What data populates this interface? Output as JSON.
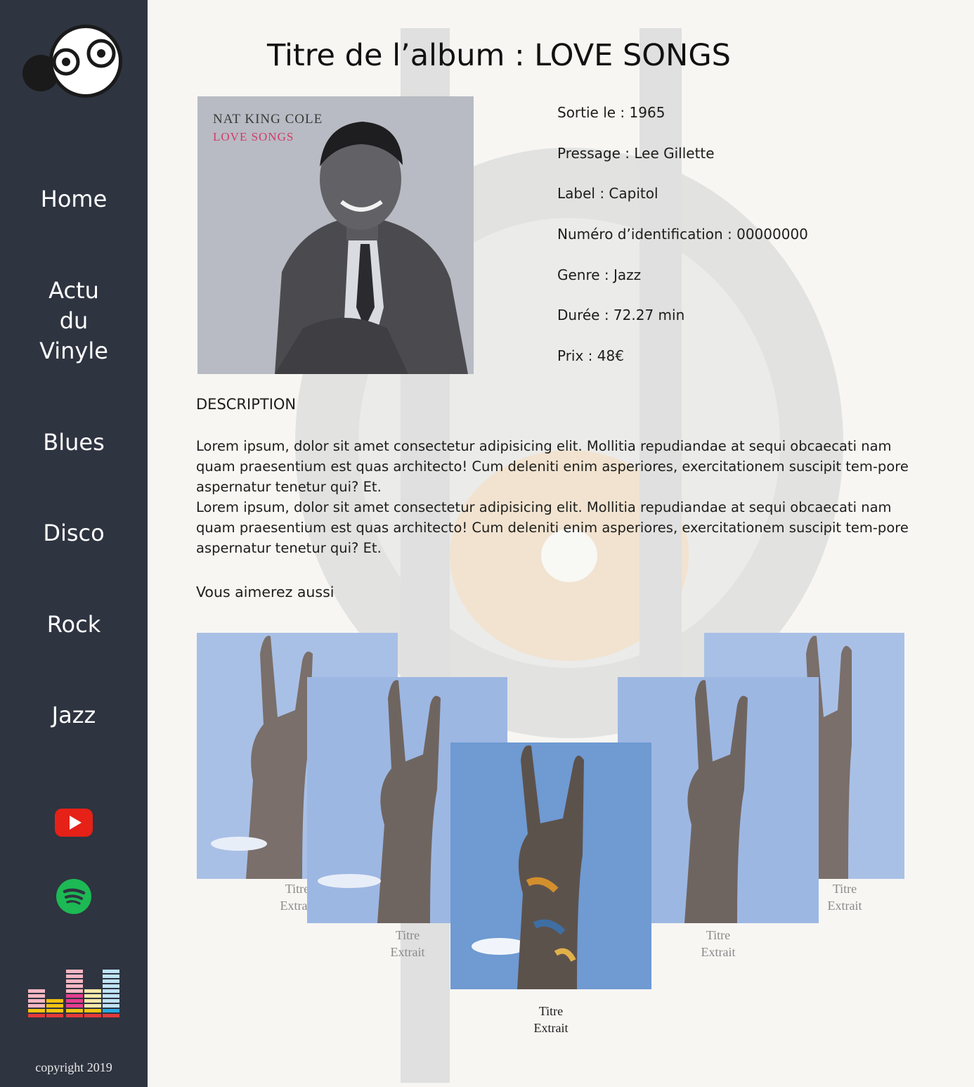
{
  "sidebar": {
    "nav": [
      "Home",
      "Actu\ndu\nVinyle",
      "Blues",
      "Disco",
      "Rock",
      "Jazz"
    ],
    "social_icons": [
      "youtube-icon",
      "spotify-icon",
      "deezer-icon"
    ],
    "copyright": "copyright 2019"
  },
  "album": {
    "title": "Titre de l’album : LOVE SONGS",
    "cover_artist": "NAT KING COLE",
    "cover_title": "LOVE SONGS",
    "info": [
      "Sortie le : 1965",
      "Pressage :  Lee Gillette",
      "Label : Capitol",
      "Numéro d’identification : 00000000",
      "Genre : Jazz",
      "Durée : 72.27 min",
      "Prix : 48€"
    ],
    "description_heading": "DESCRIPTION",
    "description": [
      "Lorem ipsum, dolor sit amet consectetur adipisicing elit. Mollitia repudiandae at sequi obcaecati nam quam praesentium est quas architecto! Cum deleniti enim asperiores, exercitationem suscipit tem-pore aspernatur tenetur qui? Et.",
      "Lorem ipsum, dolor sit amet consectetur adipisicing elit. Mollitia repudiandae at sequi obcaecati nam quam praesentium est quas architecto! Cum deleniti enim asperiores, exercitationem suscipit tem-pore aspernatur tenetur qui? Et."
    ]
  },
  "recommendations": {
    "heading": "Vous aimerez aussi",
    "cards": [
      {
        "title": "Titre",
        "subtitle": "Extrait"
      },
      {
        "title": "Titre",
        "subtitle": "Extrait"
      },
      {
        "title": "Titre",
        "subtitle": "Extrait"
      },
      {
        "title": "Titre",
        "subtitle": "Extrait"
      },
      {
        "title": "Titre",
        "subtitle": "Extrait"
      }
    ]
  },
  "colors": {
    "sidebar": "#2e3440",
    "background": "#f7f6f3",
    "youtube": "#e62117",
    "spotify": "#1db954",
    "sky": "#6f9ad2"
  }
}
